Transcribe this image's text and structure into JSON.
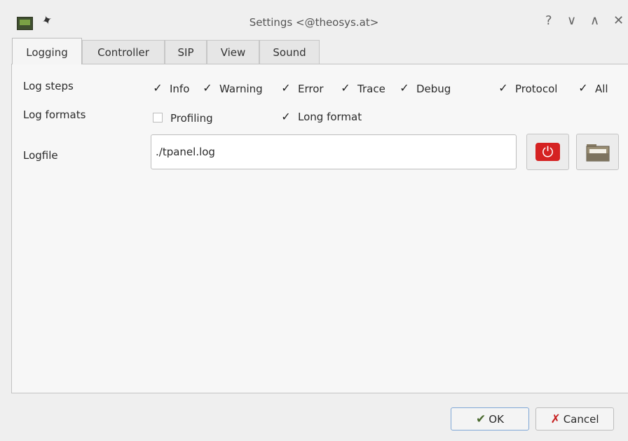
{
  "window": {
    "title": "Settings <@theosys.at>",
    "controls": {
      "help": "?",
      "minimize": "∨",
      "maximize": "∧",
      "close": "✕"
    },
    "icons": {
      "app": "monitor-icon",
      "pin": "pin-icon"
    }
  },
  "tabs": [
    {
      "label": "Logging",
      "active": true
    },
    {
      "label": "Controller",
      "active": false
    },
    {
      "label": "SIP",
      "active": false
    },
    {
      "label": "View",
      "active": false
    },
    {
      "label": "Sound",
      "active": false
    }
  ],
  "logging": {
    "log_steps_label": "Log steps",
    "log_formats_label": "Log formats",
    "logfile_label": "Logfile",
    "steps": [
      {
        "label": "Info",
        "checked": true
      },
      {
        "label": "Warning",
        "checked": true
      },
      {
        "label": "Error",
        "checked": true
      },
      {
        "label": "Trace",
        "checked": true
      },
      {
        "label": "Debug",
        "checked": true
      },
      {
        "label": "Protocol",
        "checked": true
      },
      {
        "label": "All",
        "checked": true
      }
    ],
    "formats": [
      {
        "label": "Profiling",
        "checked": false
      },
      {
        "label": "Long format",
        "checked": true
      }
    ],
    "logfile_value": "./tpanel.log",
    "reset_button_icon": "power-icon",
    "browse_button_icon": "folder-icon"
  },
  "buttons": {
    "ok": "OK",
    "cancel": "Cancel"
  },
  "colors": {
    "accent_red": "#d52222",
    "ok_border": "#7fa7d6"
  }
}
